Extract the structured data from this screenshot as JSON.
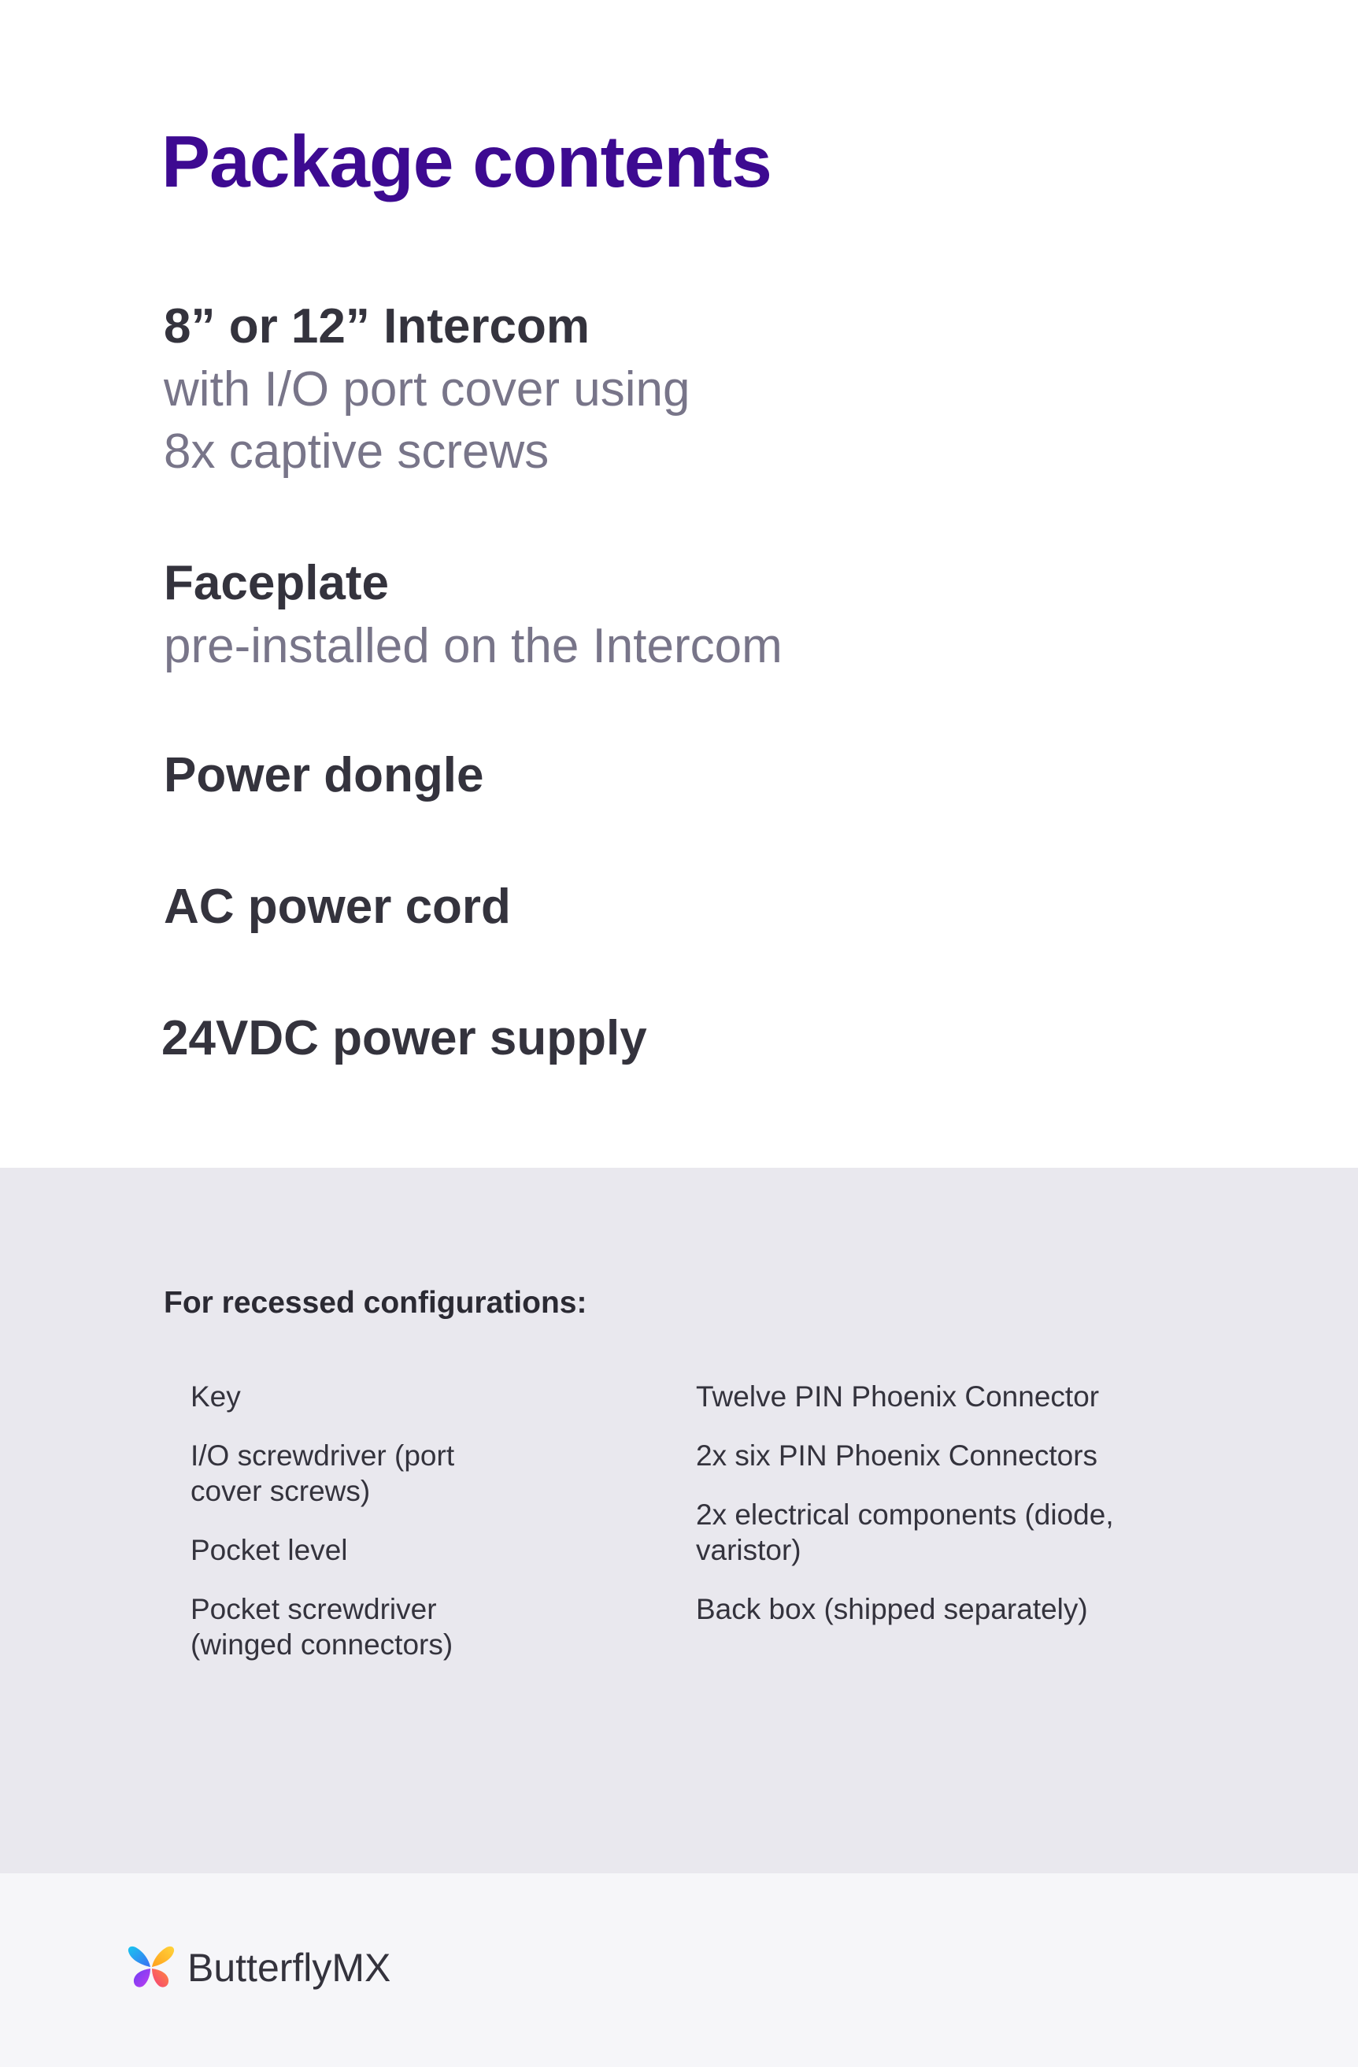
{
  "page_title": "Package contents",
  "items": [
    {
      "title": "8” or 12” Intercom",
      "desc_lines": [
        "with I/O port cover using",
        "8x captive screws"
      ]
    },
    {
      "title": "Faceplate",
      "desc_lines": [
        "pre-installed on the Intercom"
      ]
    },
    {
      "title": "Power dongle"
    },
    {
      "title": "AC power cord"
    },
    {
      "title": "24VDC power supply"
    }
  ],
  "recessed": {
    "heading": "For recessed configurations:",
    "left_items": [
      "Key",
      "I/O screwdriver (port cover screws)",
      "Pocket level",
      "Pocket screwdriver (winged connectors)"
    ],
    "right_items": [
      "Twelve PIN Phoenix Connector",
      "2x six PIN Phoenix Connectors",
      "2x electrical components (diode, varistor)",
      "Back box (shipped separately)"
    ]
  },
  "footer": {
    "brand": "ButterflyMX",
    "logo_icon": "butterfly-logo-icon"
  },
  "colors": {
    "title": "#3d0a91",
    "heading_text": "#34333d",
    "secondary_text": "#787589",
    "recessed_bg": "#e9e8ee",
    "footer_bg": "#f6f6f9"
  }
}
